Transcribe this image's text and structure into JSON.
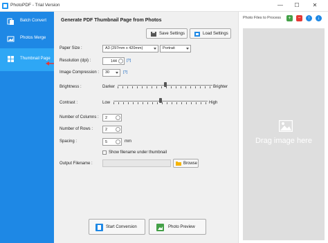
{
  "window": {
    "title": "PhotoPDF - Trial Version"
  },
  "sidebar": {
    "items": [
      {
        "label": "Batch Convert"
      },
      {
        "label": "Photos Merge"
      },
      {
        "label": "Thumbnail Page"
      }
    ]
  },
  "main": {
    "title": "Generate PDF Thumbnail Page from Photos",
    "save_settings": "Save Settings",
    "load_settings": "Load Settings",
    "paper_size": {
      "label": "Paper Size :",
      "value": "A3 (297mm x 420mm)",
      "orientation": "Portrait"
    },
    "resolution": {
      "label": "Resolution (dpi) :",
      "value": "144",
      "help": "[?]"
    },
    "compression": {
      "label": "Image Compression :",
      "value": "30",
      "help": "[?]"
    },
    "brightness": {
      "label": "Brightness :",
      "low": "Darker",
      "high": "Brighter",
      "level": 0.5
    },
    "contrast": {
      "label": "Contrast :",
      "low": "Low",
      "high": "High",
      "level": 0.5
    },
    "columns": {
      "label": "Number of Columns :",
      "value": "2"
    },
    "rows": {
      "label": "Number of Rows :",
      "value": "2"
    },
    "spacing": {
      "label": "Spacing :",
      "value": "5",
      "unit": "mm"
    },
    "show_filename": {
      "label": "Show filename under thumbnail",
      "checked": false
    },
    "output": {
      "label": "Output Filename :",
      "value": "",
      "browse": "Browse"
    },
    "start_conversion": "Start Conversion",
    "photo_preview": "Photo Preview"
  },
  "right_panel": {
    "title": "Photo Files to Process",
    "drop_text": "Drag image here"
  },
  "colors": {
    "sidebar": "#1e88e5",
    "sidebar_active": "#2ea7f5",
    "add": "#43a047",
    "remove": "#e53935",
    "move": "#1e88e5"
  }
}
